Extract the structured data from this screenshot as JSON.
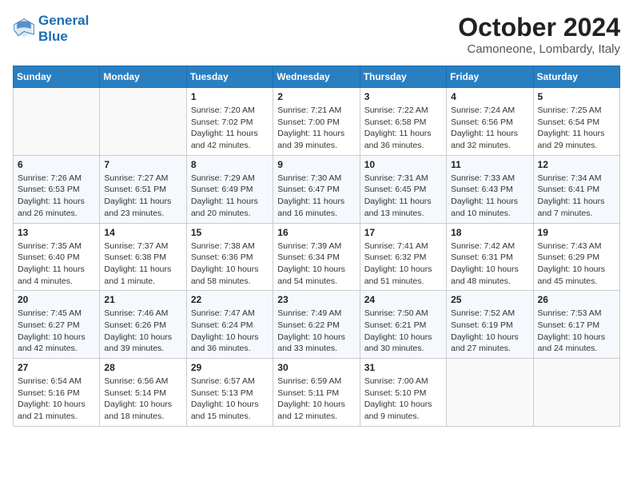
{
  "header": {
    "logo_line1": "General",
    "logo_line2": "Blue",
    "month": "October 2024",
    "location": "Camoneone, Lombardy, Italy"
  },
  "days_of_week": [
    "Sunday",
    "Monday",
    "Tuesday",
    "Wednesday",
    "Thursday",
    "Friday",
    "Saturday"
  ],
  "weeks": [
    [
      {
        "day": "",
        "info": ""
      },
      {
        "day": "",
        "info": ""
      },
      {
        "day": "1",
        "info": "Sunrise: 7:20 AM\nSunset: 7:02 PM\nDaylight: 11 hours and 42 minutes."
      },
      {
        "day": "2",
        "info": "Sunrise: 7:21 AM\nSunset: 7:00 PM\nDaylight: 11 hours and 39 minutes."
      },
      {
        "day": "3",
        "info": "Sunrise: 7:22 AM\nSunset: 6:58 PM\nDaylight: 11 hours and 36 minutes."
      },
      {
        "day": "4",
        "info": "Sunrise: 7:24 AM\nSunset: 6:56 PM\nDaylight: 11 hours and 32 minutes."
      },
      {
        "day": "5",
        "info": "Sunrise: 7:25 AM\nSunset: 6:54 PM\nDaylight: 11 hours and 29 minutes."
      }
    ],
    [
      {
        "day": "6",
        "info": "Sunrise: 7:26 AM\nSunset: 6:53 PM\nDaylight: 11 hours and 26 minutes."
      },
      {
        "day": "7",
        "info": "Sunrise: 7:27 AM\nSunset: 6:51 PM\nDaylight: 11 hours and 23 minutes."
      },
      {
        "day": "8",
        "info": "Sunrise: 7:29 AM\nSunset: 6:49 PM\nDaylight: 11 hours and 20 minutes."
      },
      {
        "day": "9",
        "info": "Sunrise: 7:30 AM\nSunset: 6:47 PM\nDaylight: 11 hours and 16 minutes."
      },
      {
        "day": "10",
        "info": "Sunrise: 7:31 AM\nSunset: 6:45 PM\nDaylight: 11 hours and 13 minutes."
      },
      {
        "day": "11",
        "info": "Sunrise: 7:33 AM\nSunset: 6:43 PM\nDaylight: 11 hours and 10 minutes."
      },
      {
        "day": "12",
        "info": "Sunrise: 7:34 AM\nSunset: 6:41 PM\nDaylight: 11 hours and 7 minutes."
      }
    ],
    [
      {
        "day": "13",
        "info": "Sunrise: 7:35 AM\nSunset: 6:40 PM\nDaylight: 11 hours and 4 minutes."
      },
      {
        "day": "14",
        "info": "Sunrise: 7:37 AM\nSunset: 6:38 PM\nDaylight: 11 hours and 1 minute."
      },
      {
        "day": "15",
        "info": "Sunrise: 7:38 AM\nSunset: 6:36 PM\nDaylight: 10 hours and 58 minutes."
      },
      {
        "day": "16",
        "info": "Sunrise: 7:39 AM\nSunset: 6:34 PM\nDaylight: 10 hours and 54 minutes."
      },
      {
        "day": "17",
        "info": "Sunrise: 7:41 AM\nSunset: 6:32 PM\nDaylight: 10 hours and 51 minutes."
      },
      {
        "day": "18",
        "info": "Sunrise: 7:42 AM\nSunset: 6:31 PM\nDaylight: 10 hours and 48 minutes."
      },
      {
        "day": "19",
        "info": "Sunrise: 7:43 AM\nSunset: 6:29 PM\nDaylight: 10 hours and 45 minutes."
      }
    ],
    [
      {
        "day": "20",
        "info": "Sunrise: 7:45 AM\nSunset: 6:27 PM\nDaylight: 10 hours and 42 minutes."
      },
      {
        "day": "21",
        "info": "Sunrise: 7:46 AM\nSunset: 6:26 PM\nDaylight: 10 hours and 39 minutes."
      },
      {
        "day": "22",
        "info": "Sunrise: 7:47 AM\nSunset: 6:24 PM\nDaylight: 10 hours and 36 minutes."
      },
      {
        "day": "23",
        "info": "Sunrise: 7:49 AM\nSunset: 6:22 PM\nDaylight: 10 hours and 33 minutes."
      },
      {
        "day": "24",
        "info": "Sunrise: 7:50 AM\nSunset: 6:21 PM\nDaylight: 10 hours and 30 minutes."
      },
      {
        "day": "25",
        "info": "Sunrise: 7:52 AM\nSunset: 6:19 PM\nDaylight: 10 hours and 27 minutes."
      },
      {
        "day": "26",
        "info": "Sunrise: 7:53 AM\nSunset: 6:17 PM\nDaylight: 10 hours and 24 minutes."
      }
    ],
    [
      {
        "day": "27",
        "info": "Sunrise: 6:54 AM\nSunset: 5:16 PM\nDaylight: 10 hours and 21 minutes."
      },
      {
        "day": "28",
        "info": "Sunrise: 6:56 AM\nSunset: 5:14 PM\nDaylight: 10 hours and 18 minutes."
      },
      {
        "day": "29",
        "info": "Sunrise: 6:57 AM\nSunset: 5:13 PM\nDaylight: 10 hours and 15 minutes."
      },
      {
        "day": "30",
        "info": "Sunrise: 6:59 AM\nSunset: 5:11 PM\nDaylight: 10 hours and 12 minutes."
      },
      {
        "day": "31",
        "info": "Sunrise: 7:00 AM\nSunset: 5:10 PM\nDaylight: 10 hours and 9 minutes."
      },
      {
        "day": "",
        "info": ""
      },
      {
        "day": "",
        "info": ""
      }
    ]
  ]
}
